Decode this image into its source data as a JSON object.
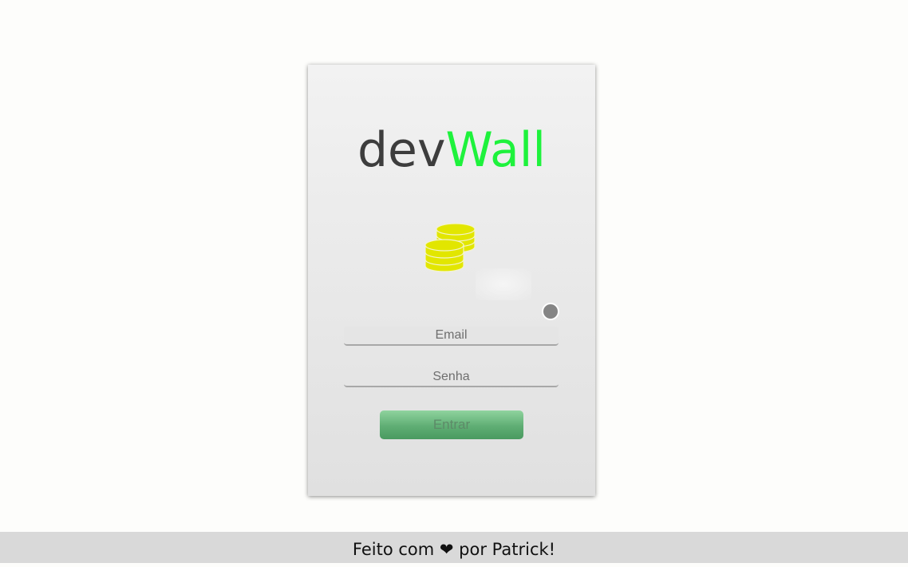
{
  "logo": {
    "part1": "dev",
    "part2": "Wall",
    "part1_color": "#3d3d3d",
    "part2_color": "#1ef23c"
  },
  "icons": {
    "coins": "coins-icon",
    "toggle": "toggle-dot"
  },
  "form": {
    "email_placeholder": "Email",
    "password_placeholder": "Senha",
    "submit_label": "Entrar"
  },
  "footer": {
    "prefix": "Feito com ",
    "heart": "❤",
    "suffix": " por Patrick!"
  },
  "colors": {
    "coin": "#e2e600",
    "button": "#5fae74",
    "footer_bg": "#d9d9d9"
  }
}
